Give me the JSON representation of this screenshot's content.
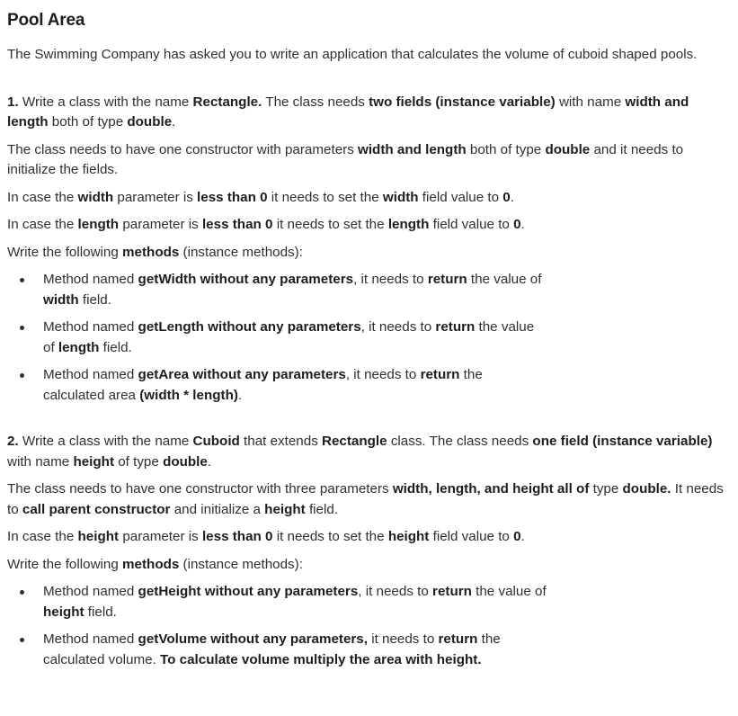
{
  "title": "Pool Area",
  "intro": "The Swimming Company has asked you to write an application that calculates the volume of cuboid shaped pools.",
  "section1": {
    "para1": [
      {
        "t": "1.",
        "b": true
      },
      {
        "t": " Write a class with the name "
      },
      {
        "t": "Rectangle.",
        "b": true
      },
      {
        "t": " The class needs "
      },
      {
        "t": "two fields (instance variable)",
        "b": true
      },
      {
        "t": " with name "
      },
      {
        "t": "width and length",
        "b": true
      },
      {
        "t": " both of type "
      },
      {
        "t": "double",
        "b": true
      },
      {
        "t": "."
      }
    ],
    "para2": [
      {
        "t": "The class needs to have one constructor with parameters "
      },
      {
        "t": "width and length",
        "b": true
      },
      {
        "t": " both of type "
      },
      {
        "t": "double",
        "b": true
      },
      {
        "t": " and it needs to initialize the fields."
      }
    ],
    "para3": [
      {
        "t": "In case the "
      },
      {
        "t": "width",
        "b": true
      },
      {
        "t": " parameter is "
      },
      {
        "t": "less than 0",
        "b": true
      },
      {
        "t": " it needs to set the "
      },
      {
        "t": "width",
        "b": true
      },
      {
        "t": " field value to "
      },
      {
        "t": "0",
        "b": true
      },
      {
        "t": "."
      }
    ],
    "para4": [
      {
        "t": "In case the "
      },
      {
        "t": "length",
        "b": true
      },
      {
        "t": " parameter is "
      },
      {
        "t": "less than 0",
        "b": true
      },
      {
        "t": " it needs to set the "
      },
      {
        "t": "length",
        "b": true
      },
      {
        "t": " field value to "
      },
      {
        "t": "0",
        "b": true
      },
      {
        "t": "."
      }
    ],
    "para5": [
      {
        "t": "Write the following "
      },
      {
        "t": "methods",
        "b": true
      },
      {
        "t": " (instance methods):"
      }
    ],
    "items": [
      [
        {
          "t": "Method named "
        },
        {
          "t": "getWidth without any parameters",
          "b": true
        },
        {
          "t": ", it needs to "
        },
        {
          "t": "return",
          "b": true
        },
        {
          "t": " the value of "
        },
        {
          "t": "width",
          "b": true
        },
        {
          "t": " field."
        }
      ],
      [
        {
          "t": "Method named "
        },
        {
          "t": "getLength without any parameters",
          "b": true
        },
        {
          "t": ", it needs to "
        },
        {
          "t": "return",
          "b": true
        },
        {
          "t": " the value of "
        },
        {
          "t": "length",
          "b": true
        },
        {
          "t": " field."
        }
      ],
      [
        {
          "t": "Method named "
        },
        {
          "t": "getArea without any parameters",
          "b": true
        },
        {
          "t": ", it needs to "
        },
        {
          "t": "return",
          "b": true
        },
        {
          "t": " the calculated area "
        },
        {
          "t": "(width * length)",
          "b": true
        },
        {
          "t": "."
        }
      ]
    ]
  },
  "section2": {
    "para1": [
      {
        "t": "2.",
        "b": true
      },
      {
        "t": " Write a class with the name "
      },
      {
        "t": "Cuboid",
        "b": true
      },
      {
        "t": " that extends "
      },
      {
        "t": "Rectangle",
        "b": true
      },
      {
        "t": " class. The class needs "
      },
      {
        "t": "one field (instance variable)",
        "b": true
      },
      {
        "t": " with name "
      },
      {
        "t": "height",
        "b": true
      },
      {
        "t": " of type "
      },
      {
        "t": "double",
        "b": true
      },
      {
        "t": "."
      }
    ],
    "para2": [
      {
        "t": "The class needs to have one constructor with three parameters "
      },
      {
        "t": "width, length, and height all of",
        "b": true
      },
      {
        "t": " type "
      },
      {
        "t": "double.",
        "b": true
      },
      {
        "t": " It needs to "
      },
      {
        "t": "call parent constructor",
        "b": true
      },
      {
        "t": " and initialize a "
      },
      {
        "t": "height",
        "b": true
      },
      {
        "t": " field."
      }
    ],
    "para3": [
      {
        "t": "In case the "
      },
      {
        "t": "height",
        "b": true
      },
      {
        "t": " parameter is "
      },
      {
        "t": "less than 0",
        "b": true
      },
      {
        "t": " it needs to set the "
      },
      {
        "t": "height",
        "b": true
      },
      {
        "t": " field value to "
      },
      {
        "t": "0",
        "b": true
      },
      {
        "t": "."
      }
    ],
    "para4": [
      {
        "t": "Write the following "
      },
      {
        "t": "methods",
        "b": true
      },
      {
        "t": " (instance methods):"
      }
    ],
    "items": [
      [
        {
          "t": "Method named "
        },
        {
          "t": "getHeight without any parameters",
          "b": true
        },
        {
          "t": ", it needs to "
        },
        {
          "t": "return",
          "b": true
        },
        {
          "t": " the value of "
        },
        {
          "t": "height",
          "b": true
        },
        {
          "t": " field."
        }
      ],
      [
        {
          "t": "Method named "
        },
        {
          "t": "getVolume without any parameters,",
          "b": true
        },
        {
          "t": " it needs to "
        },
        {
          "t": "return",
          "b": true
        },
        {
          "t": " the calculated volume. "
        },
        {
          "t": "To calculate volume multiply the area with height.",
          "b": true
        }
      ]
    ]
  }
}
